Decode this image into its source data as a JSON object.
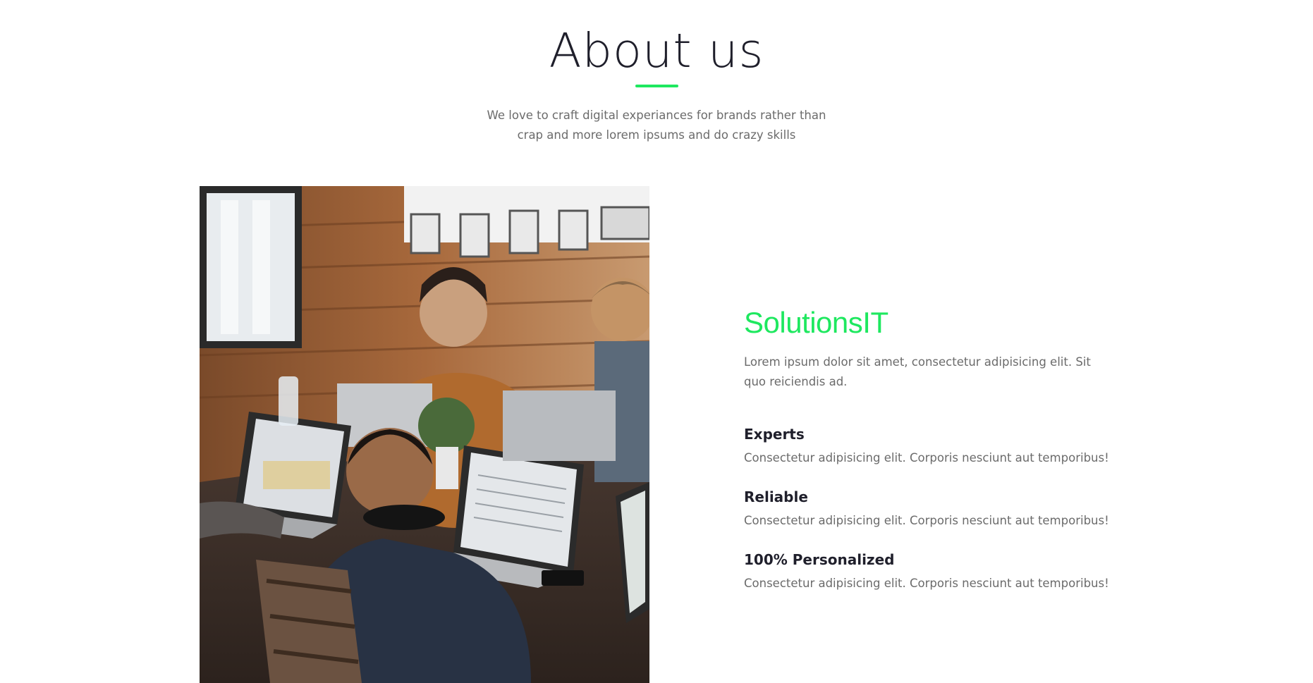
{
  "theme": {
    "accent": "#1ee85f",
    "heading_color": "#1f1f2b",
    "text_color": "#6b6b6b"
  },
  "header": {
    "title": "About us",
    "subtitle": "We love to craft digital experiances for brands rather than crap and more lorem ipsums and do crazy skills"
  },
  "photo": {
    "icon": "team-working-on-laptops-photo"
  },
  "about": {
    "heading": "SolutionsIT",
    "description": "Lorem ipsum dolor sit amet, consectetur adipisicing elit. Sit quo reiciendis ad.",
    "features": [
      {
        "title": "Experts",
        "text": "Consectetur adipisicing elit. Corporis nesciunt aut temporibus!"
      },
      {
        "title": "Reliable",
        "text": "Consectetur adipisicing elit. Corporis nesciunt aut temporibus!"
      },
      {
        "title": "100% Personalized",
        "text": "Consectetur adipisicing elit. Corporis nesciunt aut temporibus!"
      }
    ]
  }
}
